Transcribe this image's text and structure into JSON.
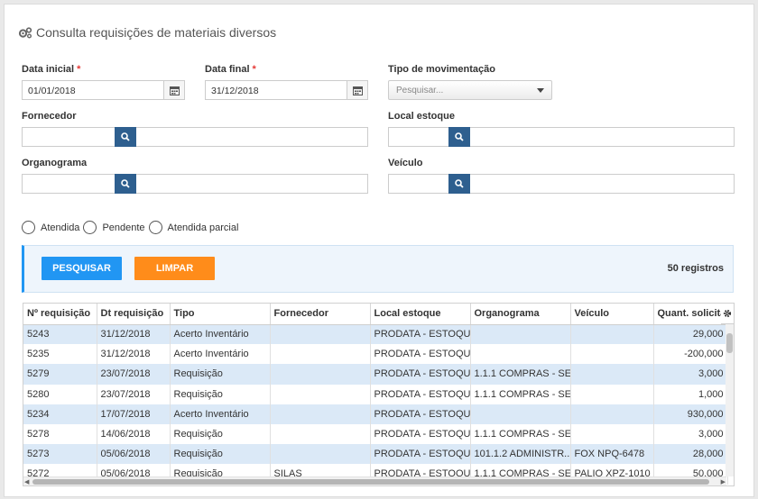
{
  "header": {
    "title": "Consulta requisições de materiais diversos",
    "icon": "gears-icon"
  },
  "form": {
    "data_inicial": {
      "label": "Data inicial",
      "required": "*",
      "value": "01/01/2018"
    },
    "data_final": {
      "label": "Data final",
      "required": "*",
      "value": "31/12/2018"
    },
    "tipo_movimentacao": {
      "label": "Tipo de movimentação",
      "placeholder": "Pesquisar..."
    },
    "fornecedor": {
      "label": "Fornecedor",
      "value": ""
    },
    "local_estoque": {
      "label": "Local estoque",
      "value": ""
    },
    "organograma": {
      "label": "Organograma",
      "value": ""
    },
    "veiculo": {
      "label": "Veículo",
      "value": ""
    }
  },
  "status_options": [
    "Atendida",
    "Pendente",
    "Atendida parcial"
  ],
  "actions": {
    "search_label": "PESQUISAR",
    "clear_label": "LIMPAR",
    "record_count": "50 registros"
  },
  "colors": {
    "search": "#2196f3",
    "clear": "#ff8c1a",
    "lookup": "#2e5f8f",
    "row_alt": "#dbe9f7"
  },
  "table": {
    "columns": [
      "Nº requisição",
      "Dt requisição",
      "Tipo",
      "Fornecedor",
      "Local estoque",
      "Organograma",
      "Veículo",
      "Quant. solicitada"
    ],
    "rows": [
      [
        "5243",
        "31/12/2018",
        "Acerto Inventário",
        "",
        "PRODATA - ESTOQUE",
        "",
        "",
        "29,000"
      ],
      [
        "5235",
        "31/12/2018",
        "Acerto Inventário",
        "",
        "PRODATA - ESTOQUE",
        "",
        "",
        "-200,000"
      ],
      [
        "5279",
        "23/07/2018",
        "Requisição",
        "",
        "PRODATA - ESTOQUE",
        "1.1.1 COMPRAS - SE...",
        "",
        "3,000"
      ],
      [
        "5280",
        "23/07/2018",
        "Requisição",
        "",
        "PRODATA - ESTOQUE",
        "1.1.1 COMPRAS - SE...",
        "",
        "1,000"
      ],
      [
        "5234",
        "17/07/2018",
        "Acerto Inventário",
        "",
        "PRODATA - ESTOQUE",
        "",
        "",
        "930,000"
      ],
      [
        "5278",
        "14/06/2018",
        "Requisição",
        "",
        "PRODATA - ESTOQUE",
        "1.1.1 COMPRAS - SE...",
        "",
        "3,000"
      ],
      [
        "5273",
        "05/06/2018",
        "Requisição",
        "",
        "PRODATA - ESTOQUE",
        "101.1.2 ADMINISTR...",
        "FOX NPQ-6478",
        "28,000"
      ],
      [
        "5272",
        "05/06/2018",
        "Requisição",
        "SILAS",
        "PRODATA - ESTOQUE",
        "1.1.1 COMPRAS - SE...",
        "PALIO XPZ-1010",
        "50,000"
      ]
    ]
  }
}
